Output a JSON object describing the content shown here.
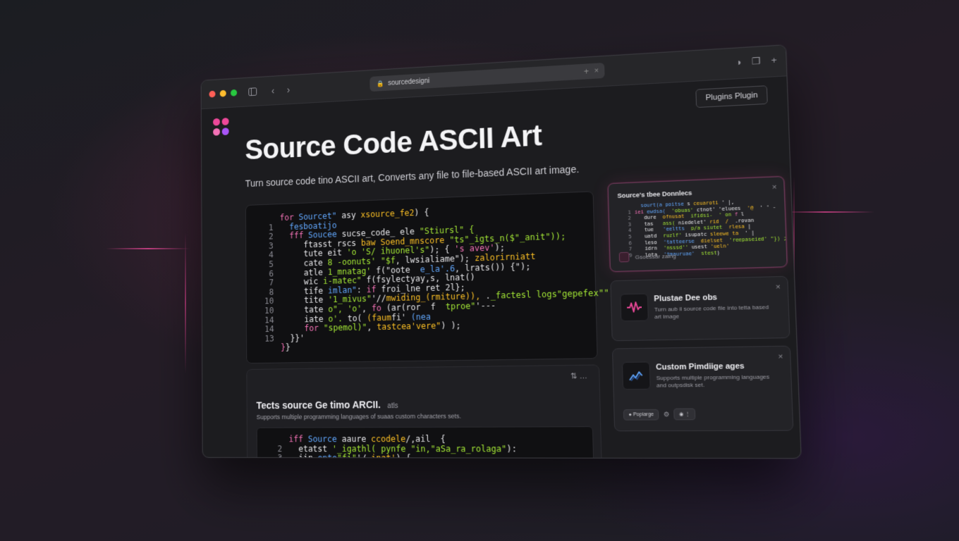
{
  "browser": {
    "url": "sourcedesigni",
    "new_tab_icon": "plus-icon",
    "close_tab_icon": "close-icon"
  },
  "header": {
    "signin_label": "Plugins Plugin"
  },
  "hero": {
    "title": "Source Code ASCII Art",
    "subtitle": "Turn source code tino ASCII art, Converts any file to file-based ASCII art image."
  },
  "code_main": [
    {
      "n": "",
      "parts": [
        [
          "k",
          "for "
        ],
        [
          "c",
          "Sourcet\""
        ],
        [
          "v",
          " asy "
        ],
        [
          "o",
          "xsource_fe2"
        ],
        [
          "v",
          ") {"
        ]
      ]
    },
    {
      "n": "1",
      "parts": [
        [
          "c",
          "  fesboatijo"
        ]
      ]
    },
    {
      "n": "2",
      "parts": [
        [
          "k",
          "  fff "
        ],
        [
          "c",
          "Soucee "
        ],
        [
          "v",
          "sucse_code_ ele "
        ],
        [
          "s",
          "\"Stiursl\" {"
        ]
      ]
    },
    {
      "n": "3",
      "parts": [
        [
          "v",
          "     ftasst rscs "
        ],
        [
          "o",
          "baw Soend_mnscore"
        ],
        [
          "s",
          " \"ts\"_igts_n($\"_anit\"));"
        ]
      ]
    },
    {
      "n": "4",
      "parts": [
        [
          "v",
          "     tute eit "
        ],
        [
          "s",
          "'o 'S/ ihuonel's\""
        ],
        [
          "v",
          "); { "
        ],
        [
          "k",
          "'s avev'"
        ],
        [
          "v",
          ");"
        ]
      ]
    },
    {
      "n": "5",
      "parts": [
        [
          "v",
          "     cate "
        ],
        [
          "s",
          "8 -oonuts' \"$f"
        ],
        [
          "v",
          ", lwsialiame\"); "
        ],
        [
          "o",
          "zalorirniatt"
        ]
      ]
    },
    {
      "n": "6",
      "parts": [
        [
          "v",
          "     atle "
        ],
        [
          "s",
          "1_mnatag' "
        ],
        [
          "v",
          "f(\"oote  "
        ],
        [
          "c",
          "e_la'.6"
        ],
        [
          "v",
          ", lrats()) {\");"
        ]
      ]
    },
    {
      "n": "7",
      "parts": [
        [
          "v",
          "     wic "
        ],
        [
          "s",
          "i-matec\""
        ],
        [
          "v",
          " f(fsylectyay,s, lnat()"
        ]
      ]
    },
    {
      "n": "8",
      "parts": [
        [
          "v",
          "     tife "
        ],
        [
          "c",
          "imlan\""
        ],
        [
          "v",
          ": "
        ],
        [
          "k",
          "if "
        ],
        [
          "v",
          "froi_lne ret 2l};"
        ]
      ]
    },
    {
      "n": "10",
      "parts": [
        [
          "v",
          "     tite "
        ],
        [
          "s",
          "'1_mivus\""
        ],
        [
          "v",
          "'//"
        ],
        [
          "o",
          "mwiding_(rmiture)),"
        ],
        [
          "v",
          " ."
        ],
        [
          "s",
          "_factesl logs\"gepefex\"\");"
        ]
      ]
    },
    {
      "n": "10",
      "parts": [
        [
          "v",
          "     tate "
        ],
        [
          "s",
          "o\", 'o'"
        ],
        [
          "v",
          ", "
        ],
        [
          "k",
          "fo "
        ],
        [
          "v",
          "(ar(ror  f  "
        ],
        [
          "s",
          "tproe\""
        ],
        [
          "v",
          "'---"
        ]
      ]
    },
    {
      "n": "14",
      "parts": [
        [
          "v",
          "     iate "
        ],
        [
          "s",
          "o'. "
        ],
        [
          "v",
          "to( "
        ],
        [
          "o",
          "(faum"
        ],
        [
          "v",
          "fi' "
        ],
        [
          "c",
          "(nea"
        ]
      ]
    },
    {
      "n": "14",
      "parts": [
        [
          "k",
          "     for "
        ],
        [
          "s",
          "\"spemol)\""
        ],
        [
          "v",
          ", "
        ],
        [
          "o",
          "tastcea'vere\""
        ],
        [
          "v",
          ") );"
        ]
      ]
    },
    {
      "n": "13",
      "parts": [
        [
          "v",
          "  }}'"
        ]
      ]
    },
    {
      "n": "",
      "parts": [
        [
          "k",
          "}"
        ],
        [
          "v",
          "}"
        ]
      ]
    }
  ],
  "card2": {
    "title": "Tects source Ge timo ARCII.",
    "title_suffix": "atls",
    "subtitle": "Supports multiple programming languages of suaas custom characters sets.",
    "controls": "⇅ …",
    "code": [
      {
        "n": "",
        "parts": [
          [
            "k",
            "iff "
          ],
          [
            "c",
            "Source "
          ],
          [
            "v",
            "aaure "
          ],
          [
            "o",
            "ccodele"
          ],
          [
            "v",
            "/,ail  {"
          ]
        ]
      },
      {
        "n": "2",
        "parts": [
          [
            "v",
            "  etatst "
          ],
          [
            "s",
            "'_igathl( pynfe "
          ],
          [
            "s",
            "\"in,\"aSa_ra_rolaga\""
          ],
          [
            "v",
            "):"
          ]
        ]
      },
      {
        "n": "3",
        "parts": [
          [
            "v",
            "  iin "
          ],
          [
            "c",
            "ento"
          ],
          [
            "s",
            "\"fi\""
          ],
          [
            "v",
            "'/ "
          ],
          [
            "o",
            "inat'"
          ],
          [
            "v",
            ") {"
          ]
        ]
      }
    ]
  },
  "panel_preview": {
    "title": "Source's tbee Donnlecs",
    "footer": "Gsoessar zaing",
    "code": [
      {
        "n": "",
        "parts": [
          [
            "v",
            "  "
          ],
          [
            "c",
            "sourt(a poitse"
          ],
          [
            "v",
            " s "
          ],
          [
            "o",
            "ceuaroti"
          ],
          [
            "v",
            " ' |,"
          ]
        ]
      },
      {
        "n": "1",
        "parts": [
          [
            "k",
            "iei "
          ],
          [
            "c",
            "ewdsa("
          ],
          [
            "s",
            "  'obuas' "
          ],
          [
            "v",
            "ctnot' 'eluees"
          ],
          [
            "o",
            "  '@"
          ],
          [
            "v",
            "  ' ' -"
          ]
        ]
      },
      {
        "n": "2",
        "parts": [
          [
            "v",
            "   dure  "
          ],
          [
            "o",
            "ofnusat"
          ],
          [
            "v",
            "  "
          ],
          [
            "s",
            "ifidsi-  ' on"
          ],
          [
            "k",
            " f "
          ],
          [
            "v",
            "l"
          ]
        ]
      },
      {
        "n": "3",
        "parts": [
          [
            "v",
            "   tas   "
          ],
          [
            "s",
            "ass( "
          ],
          [
            "v",
            "niedelet' "
          ],
          [
            "o",
            "rid  /"
          ],
          [
            "v",
            "  .rovan"
          ]
        ]
      },
      {
        "n": "4",
        "parts": [
          [
            "v",
            "   tue   "
          ],
          [
            "c",
            "'eeltts"
          ],
          [
            "v",
            "  "
          ],
          [
            "s",
            "p/a siutet  "
          ],
          [
            "o",
            "rlesa"
          ],
          [
            "v",
            " |"
          ]
        ]
      },
      {
        "n": "5",
        "parts": [
          [
            "v",
            "   uatd  "
          ],
          [
            "s",
            "ruzlf' "
          ],
          [
            "v",
            "isupatc"
          ],
          [
            "o",
            " sleewe ta"
          ],
          [
            "v",
            "  ' |"
          ]
        ]
      },
      {
        "n": "6",
        "parts": [
          [
            "v",
            "   leso  "
          ],
          [
            "c",
            "'tatteerse"
          ],
          [
            "v",
            "  "
          ],
          [
            "o",
            "dielset"
          ],
          [
            "s",
            "  'reepaseied' \"}) ;"
          ]
        ]
      },
      {
        "n": "7",
        "parts": [
          [
            "v",
            "   idrn  "
          ],
          [
            "s",
            "'nsssd'' "
          ],
          [
            "v",
            "usest"
          ],
          [
            "o",
            " 'ueln'"
          ]
        ]
      },
      {
        "n": "9",
        "parts": [
          [
            "v",
            "   lota  "
          ],
          [
            "c",
            "'tmauruae'"
          ],
          [
            "v",
            "  "
          ],
          [
            "s",
            "stest"
          ],
          [
            "v",
            ")"
          ]
        ]
      }
    ]
  },
  "feature_1": {
    "title": "Plustae Dee obs",
    "description": "Turn aub il source code file into tetta based art image",
    "icon": "waveform-icon"
  },
  "feature_2": {
    "title": "Custom Pimdiige ages",
    "description": "Supports multiple programming languages and outpsdisk set.",
    "icon": "chart-trend-icon",
    "chip_label": "Popiarge",
    "chip2_icon": "gear-icon"
  },
  "colors": {
    "accent_pink": "#ec4899",
    "accent_purple": "#a855f7",
    "dot_red": "#ff5f57",
    "dot_yellow": "#febc2e",
    "dot_green": "#28c840"
  }
}
